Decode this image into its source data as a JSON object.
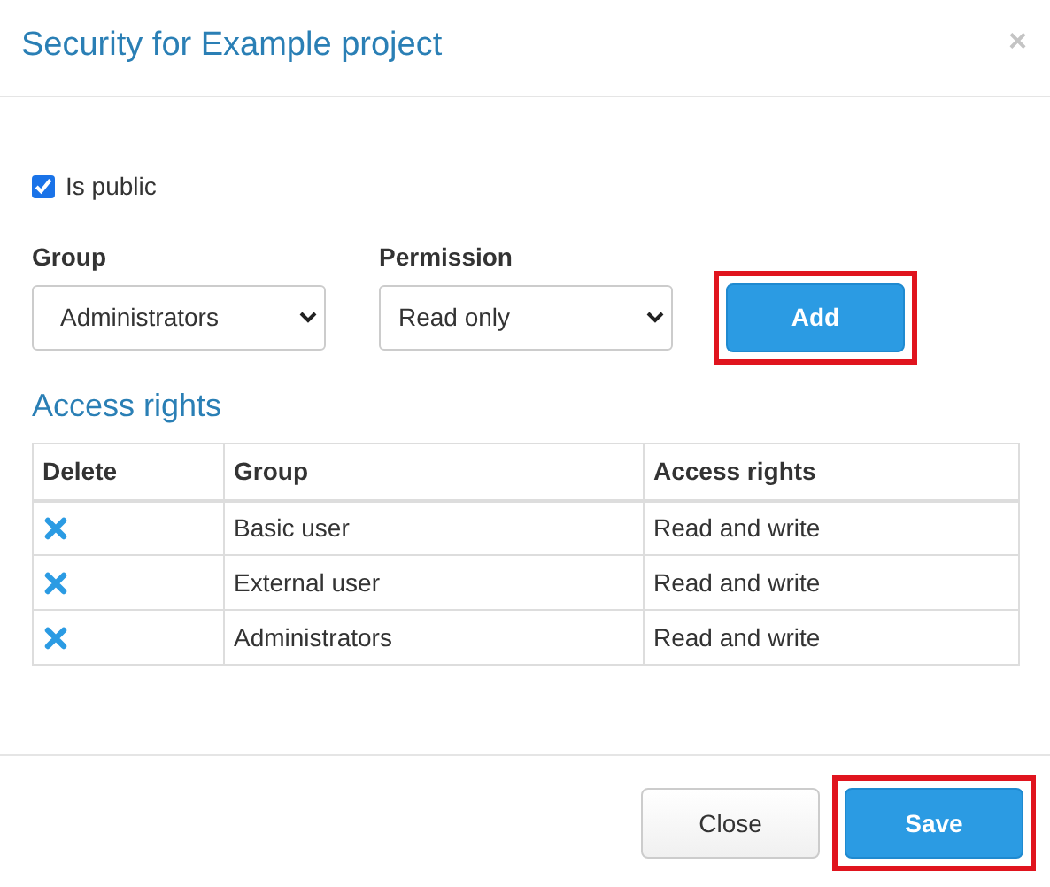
{
  "dialog": {
    "title": "Security for Example project",
    "close_icon": "×"
  },
  "is_public": {
    "label": "Is public",
    "checked": true
  },
  "group_field": {
    "label": "Group",
    "value": "Administrators"
  },
  "permission_field": {
    "label": "Permission",
    "value": "Read only"
  },
  "add_button": {
    "label": "Add",
    "highlighted": true
  },
  "access_rights": {
    "heading": "Access rights",
    "columns": [
      "Delete",
      "Group",
      "Access rights"
    ],
    "rows": [
      {
        "group": "Basic user",
        "access": "Read and write"
      },
      {
        "group": "External user",
        "access": "Read and write"
      },
      {
        "group": "Administrators",
        "access": "Read and write"
      }
    ]
  },
  "footer_buttons": [
    {
      "label": "Close",
      "kind": "default",
      "highlighted": false
    },
    {
      "label": "Save",
      "kind": "primary",
      "highlighted": true
    }
  ]
}
